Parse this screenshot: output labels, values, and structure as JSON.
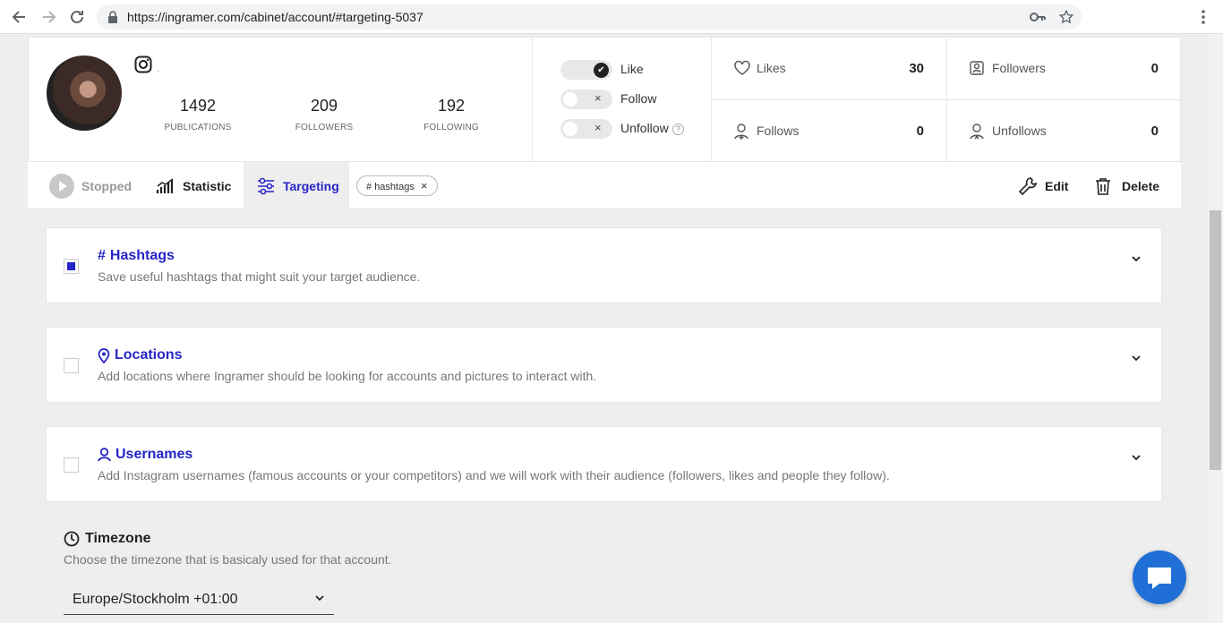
{
  "browser": {
    "url": "https://ingramer.com/cabinet/account/#targeting-5037",
    "icons": [
      "back-icon",
      "forward-icon",
      "reload-icon",
      "lock-icon",
      "key-icon",
      "star-icon",
      "menu-icon"
    ]
  },
  "profile": {
    "username_dot": ".",
    "stats": [
      {
        "value": "1492",
        "label": "PUBLICATIONS"
      },
      {
        "value": "209",
        "label": "FOLLOWERS"
      },
      {
        "value": "192",
        "label": "FOLLOWING"
      }
    ]
  },
  "actions": {
    "like": {
      "label": "Like",
      "enabled": true
    },
    "follow": {
      "label": "Follow",
      "enabled": false
    },
    "unfollow": {
      "label": "Unfollow",
      "enabled": false,
      "help": "?"
    }
  },
  "metrics": {
    "likes": {
      "label": "Likes",
      "value": "30"
    },
    "followers": {
      "label": "Followers",
      "value": "0"
    },
    "follows": {
      "label": "Follows",
      "value": "0"
    },
    "unfollows": {
      "label": "Unfollows",
      "value": "0"
    }
  },
  "tabs": {
    "stopped": "Stopped",
    "statistic": "Statistic",
    "targeting": "Targeting",
    "chip": "hashtags",
    "chip_prefix": "#",
    "chip_close": "×",
    "edit": "Edit",
    "delete": "Delete"
  },
  "panels": {
    "hashtags": {
      "title": "Hashtags",
      "icon": "#",
      "desc": "Save useful hashtags that might suit your target audience.",
      "checked": true
    },
    "locations": {
      "title": "Locations",
      "desc": "Add locations where Ingramer should be looking for accounts and pictures to interact with.",
      "checked": false
    },
    "usernames": {
      "title": "Usernames",
      "desc": "Add Instagram usernames (famous accounts or your competitors) and we will work with their audience (followers, likes and people they follow).",
      "checked": false
    }
  },
  "timezone": {
    "title": "Timezone",
    "desc": "Choose the timezone that is basicaly used for that account.",
    "value": "Europe/Stockholm +01:00"
  },
  "colors": {
    "accent": "#2525c7",
    "chat": "#1f6fd6"
  }
}
